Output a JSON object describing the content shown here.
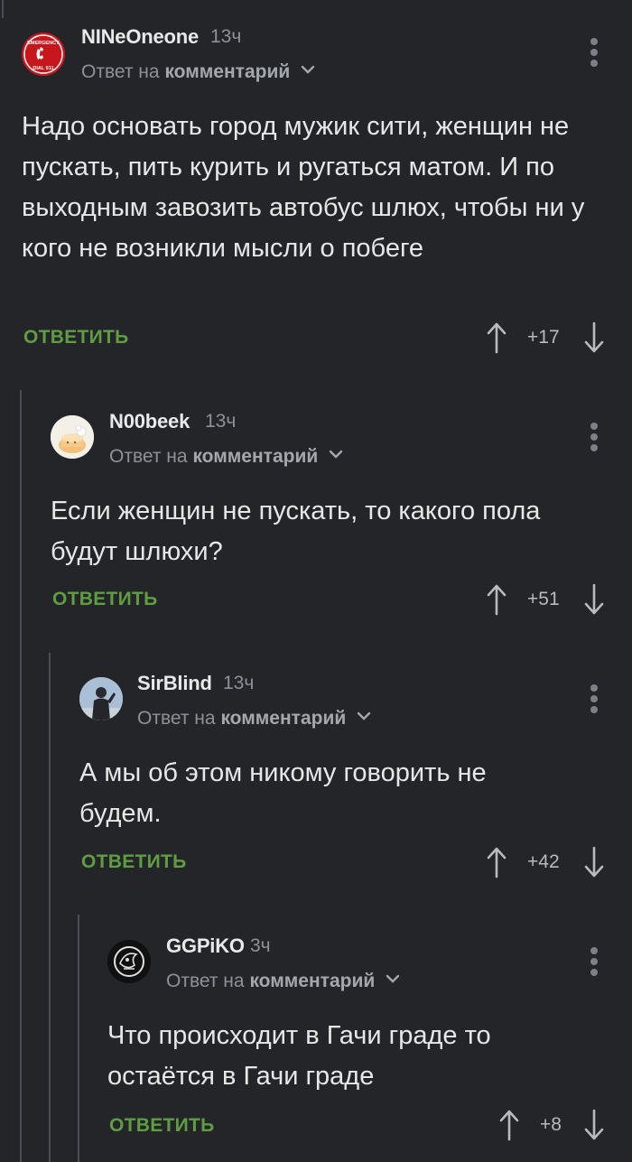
{
  "comments": [
    {
      "username": "NINeOneone",
      "time": "13ч",
      "reply_prefix": "Ответ на",
      "reply_target": "комментарий",
      "text": "Надо основать город мужик сити, женщин не пускать, пить курить и ругаться матом. И по выходным завозить автобус шлюх, чтобы ни у кого не возникли мысли о побеге",
      "reply_label": "ОТВЕТИТЬ",
      "score": "+17",
      "avatar": {
        "type": "emergency-badge",
        "line1": "EMERGENCY",
        "line2": "DIAL 911"
      }
    },
    {
      "username": "N00beek",
      "time": "13ч",
      "reply_prefix": "Ответ на",
      "reply_target": "комментарий",
      "text": "Если женщин не пускать, то какого пола будут шлюхи?",
      "reply_label": "ОТВЕТИТЬ",
      "score": "+51",
      "avatar": {
        "type": "cartoon-cake"
      }
    },
    {
      "username": "SirBlind",
      "time": "13ч",
      "reply_prefix": "Ответ на",
      "reply_target": "комментарий",
      "text": "А мы об этом никому говорить не будем.",
      "reply_label": "ОТВЕТИТЬ",
      "score": "+42",
      "avatar": {
        "type": "person-photo"
      }
    },
    {
      "username": "GGPiKO",
      "time": "3ч",
      "reply_prefix": "Ответ на",
      "reply_target": "комментарий",
      "text": "Что происходит в Гачи граде то остаётся в Гачи граде",
      "reply_label": "ОТВЕТИТЬ",
      "score": "+8",
      "avatar": {
        "type": "dark-emblem"
      }
    }
  ],
  "colors": {
    "background": "#232528",
    "accent_green": "#5f9d43",
    "muted": "#8e9196",
    "text": "#e7e7e7",
    "thread_line": "#4a4d51"
  },
  "icons": [
    "arrow-up-icon",
    "arrow-down-icon",
    "chevron-down-icon",
    "more-vertical-icon"
  ]
}
